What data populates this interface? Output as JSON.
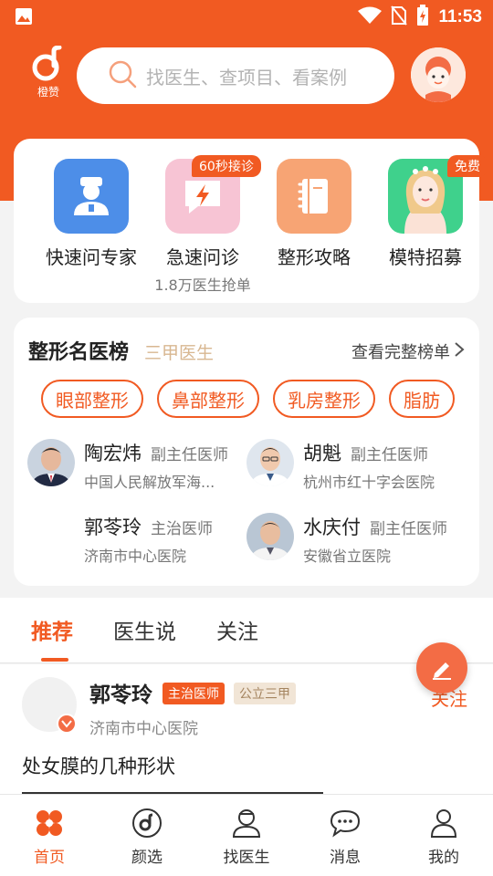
{
  "status_bar": {
    "time": "11:53"
  },
  "header": {
    "brand": "橙赞",
    "search_placeholder": "找医生、查项目、看案例"
  },
  "quick_actions": [
    {
      "label": "快速问专家",
      "sub": "",
      "badge": ""
    },
    {
      "label": "急速问诊",
      "sub": "1.8万医生抢单",
      "badge": "60秒接诊"
    },
    {
      "label": "整形攻略",
      "sub": "",
      "badge": ""
    },
    {
      "label": "模特招募",
      "sub": "",
      "badge": "免费"
    }
  ],
  "ranking": {
    "title": "整形名医榜",
    "subtitle": "三甲医生",
    "more": "查看完整榜单",
    "categories": [
      "眼部整形",
      "鼻部整形",
      "乳房整形",
      "脂肪"
    ],
    "doctors": [
      {
        "name": "陶宏炜",
        "title": "副主任医师",
        "hospital": "中国人民解放军海..."
      },
      {
        "name": "胡魁",
        "title": "副主任医师",
        "hospital": "杭州市红十字会医院"
      },
      {
        "name": "郭苓玲",
        "title": "主治医师",
        "hospital": "济南市中心医院"
      },
      {
        "name": "水庆付",
        "title": "副主任医师",
        "hospital": "安徽省立医院"
      }
    ]
  },
  "tabs": [
    "推荐",
    "医生说",
    "关注"
  ],
  "feed": {
    "name": "郭苓玲",
    "tag_title": "主治医师",
    "tag_level": "公立三甲",
    "hospital": "济南市中心医院",
    "follow": "关注",
    "post_title": "处女膜的几种形状"
  },
  "bottom_nav": [
    "首页",
    "颜选",
    "找医生",
    "消息",
    "我的"
  ],
  "colors": {
    "accent": "#f15a22",
    "gold": "#d8b791"
  }
}
